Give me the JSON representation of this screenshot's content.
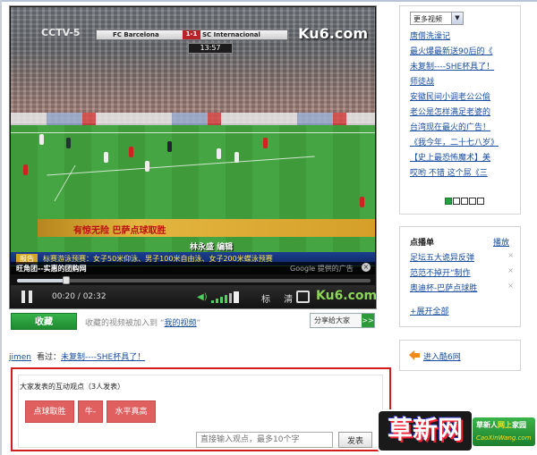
{
  "player": {
    "channel_logo": "CCTV-5",
    "scoreboard": {
      "team1": "FC Barcelona",
      "score": "1-1",
      "team2": "SC Internacional"
    },
    "match_time": "13:57",
    "watermark": "Ku6.com",
    "caption_main": "有惊无险 巴萨点球取胜",
    "caption_sub": "林永盛 编辑",
    "ticker_label": "报告",
    "ticker_text": "标赛游泳预赛：女子50米仰泳、男子100米自由泳、女子200米蝶泳预赛",
    "info_title": "旺角团--实惠的团购网",
    "info_ad": "Google 提供的广告",
    "progress_fraction": 0.14,
    "time": "00:20 / 02:32",
    "quality_label": "标 清",
    "brand_logo": "Ku6.com"
  },
  "favorite": {
    "button": "收藏",
    "hint_prefix": "收藏的视频被加入到 “",
    "hint_link": "我的视频",
    "hint_suffix": "”"
  },
  "share": {
    "label": "分享给大家",
    "arrow": ">>"
  },
  "watched": {
    "user": "jimen",
    "label": "看过：",
    "video": "未复制----SHE杯具了！"
  },
  "discussion": {
    "title": "大家发表的互动观点（3人发表）",
    "tags": [
      "点球取胜",
      "牛-",
      "水平真高"
    ],
    "input_placeholder": "直接输入观点，最多10个字",
    "submit": "发表"
  },
  "sidebar": {
    "more_select": "更多视频",
    "more_links": [
      "唐僧洗澡记",
      "最火爆最新送90后的《",
      "未复制----SHE杯具了！",
      "师徒战",
      "安徽民间小调老公公偷",
      "老公是怎样满足老婆的",
      "台湾现在最火的广告！",
      "《我今年，二十七八岁》",
      "【史上最恐怖魔术】美",
      "哎哟 不错 这个屌《三"
    ],
    "pager_count": 5,
    "pager_active": 0,
    "rank_title": "点播单",
    "rank_action": "播放",
    "rank_items": [
      "足坛五大诡异反弹",
      "范范不掉开“制作",
      "奥迪杯-巴萨点球胜"
    ],
    "expand_all": "+展开全部",
    "ku6_link": "进入酷6网"
  },
  "watermark": {
    "big": "草新网",
    "slogan_prefix": "草新人",
    "slogan_highlight": "网上",
    "slogan_suffix": "家园",
    "url": "CaoXinWang.com"
  }
}
